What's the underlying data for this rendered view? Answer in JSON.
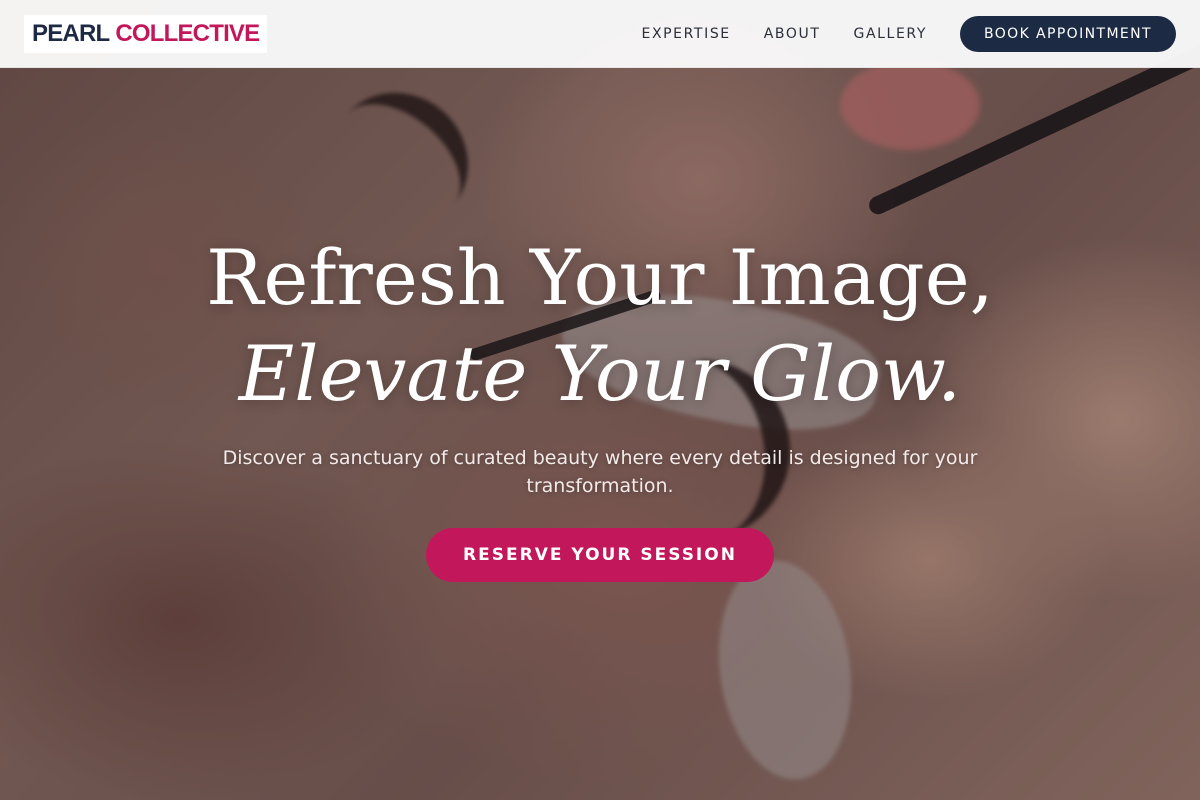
{
  "header": {
    "logo_part1": "PEARL",
    "logo_part2": "COLLECTIVE",
    "nav": [
      {
        "label": "EXPERTISE"
      },
      {
        "label": "ABOUT"
      },
      {
        "label": "GALLERY"
      }
    ],
    "book_label": "BOOK APPOINTMENT"
  },
  "hero": {
    "headline_line1": "Refresh Your Image,",
    "headline_line2": "Elevate Your Glow.",
    "subtext": "Discover a sanctuary of curated beauty where every detail is designed for your transformation.",
    "cta_label": "RESERVE YOUR SESSION"
  },
  "colors": {
    "brand_navy": "#1c2a44",
    "brand_pink": "#c2185b"
  }
}
